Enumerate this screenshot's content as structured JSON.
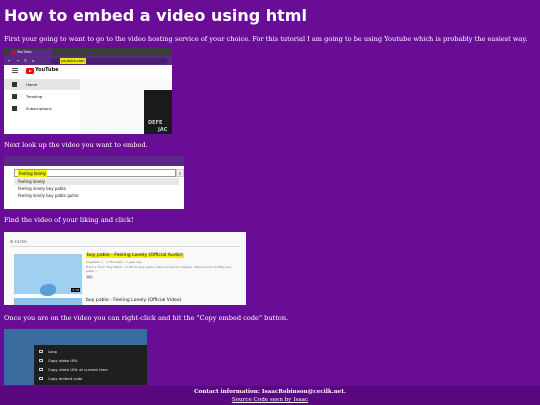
{
  "page": {
    "title": "How to embed a video using html",
    "intro": "First your going to want to go to the video hosting service of your choice. For this tutorial I am going to be using Youtube which is probably the easiest way.",
    "step2": "Next look up the video you want to embed.",
    "step3": "Find the video of your liking and click!",
    "step4": "Once you are on the video you can right-click and hit the \"Copy embed code\" button."
  },
  "shot1": {
    "tab_label": "YouTube",
    "url": "youtube.com",
    "logo_text": "YouTube",
    "sidebar": [
      "Home",
      "Trending",
      "Subscriptions"
    ],
    "thumb_line1": "DEFE",
    "thumb_line2": "JAC"
  },
  "shot2": {
    "query": "feeling lonely",
    "suggestions": [
      "feeling lonely",
      "feeling lonely boy pablo",
      "feeling lonely boy pablo guitar"
    ]
  },
  "shot3": {
    "filter_label": "FILTER",
    "video1_title": "boy pablo - Feeling Lonely (Official Audio)",
    "video1_meta": "boypablo ✓ · 1.7M views · 1 year ago",
    "video1_desc": "Track 1 from \"Soy Pablo\", an EP by boy pablo. Listen to the full release: https://rocnrl.lk/SPep boy pablo ...",
    "video1_badge": "HD",
    "video1_duration": "3:16",
    "video2_title": "boy pablo - Feeling Lonely (Official Video)"
  },
  "shot4": {
    "menu": [
      "Loop",
      "Copy video URL",
      "Copy video URL at current time",
      "Copy embed code"
    ]
  },
  "footer": {
    "contact": "Contact information: IsaacRobinson@cecilk.net.",
    "source": "Source Code seen by Isaac"
  },
  "colors": {
    "background": "#6a0d96",
    "footer": "#5a0880"
  }
}
